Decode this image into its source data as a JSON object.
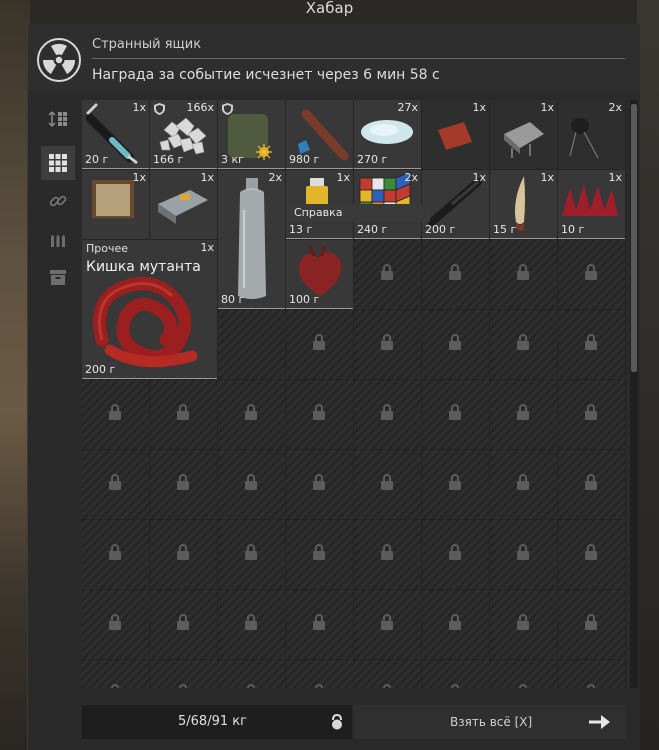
{
  "window": {
    "title": "Хабар"
  },
  "header": {
    "container_name": "Странный ящик",
    "timer_text": "Награда за событие исчезнет через 6 мин 58 с",
    "icon": "radiation-icon"
  },
  "tabs": [
    {
      "name": "sort",
      "icon": "sort-icon",
      "active": false
    },
    {
      "name": "grid",
      "icon": "grid-icon",
      "active": true
    },
    {
      "name": "attachments",
      "icon": "link-icon",
      "active": false
    },
    {
      "name": "ammo",
      "icon": "ammo-icon",
      "active": false
    },
    {
      "name": "storage",
      "icon": "box-icon",
      "active": false
    }
  ],
  "tooltip": {
    "text": "Справка",
    "extra": "x"
  },
  "items": [
    {
      "id": "syringe",
      "qty": "1x",
      "weight": "20 г",
      "shield": false
    },
    {
      "id": "crystals",
      "qty": "166x",
      "weight": "166 г",
      "shield": true
    },
    {
      "id": "suit",
      "qty": "",
      "weight": "3 кг",
      "shield": true
    },
    {
      "id": "ammo-stick",
      "qty": "",
      "weight": "980 г",
      "shield": false
    },
    {
      "id": "salt",
      "qty": "27x",
      "weight": "270 г",
      "shield": false
    },
    {
      "id": "red-chip",
      "qty": "1x",
      "weight": "",
      "shield": false
    },
    {
      "id": "metal-part",
      "qty": "1x",
      "weight": "",
      "shield": false
    },
    {
      "id": "capacitor",
      "qty": "2x",
      "weight": "",
      "shield": false
    },
    {
      "id": "transformer",
      "qty": "1x",
      "weight": "",
      "shield": false
    },
    {
      "id": "device",
      "qty": "1x",
      "weight": "",
      "shield": false
    },
    {
      "id": "bottle",
      "qty": "2x",
      "weight": "80 г",
      "shield": false
    },
    {
      "id": "lighter",
      "qty": "1x",
      "weight": "13 г",
      "shield": false
    },
    {
      "id": "cube",
      "qty": "2x",
      "weight": "240 г",
      "shield": false
    },
    {
      "id": "knife",
      "qty": "1x",
      "weight": "200 г",
      "shield": false
    },
    {
      "id": "fang",
      "qty": "1x",
      "weight": "15 г",
      "shield": false
    },
    {
      "id": "red-spikes",
      "qty": "1x",
      "weight": "10 г",
      "shield": false
    },
    {
      "id": "heart",
      "qty": "",
      "weight": "100 г",
      "shield": false
    },
    {
      "id": "gut",
      "qty": "1x",
      "weight": "200 г",
      "category": "Прочее",
      "name": "Кишка мутанта",
      "shield": false
    }
  ],
  "footer": {
    "weight_text": "5/68/91 кг",
    "take_all_label": "Взять всё [X]"
  }
}
